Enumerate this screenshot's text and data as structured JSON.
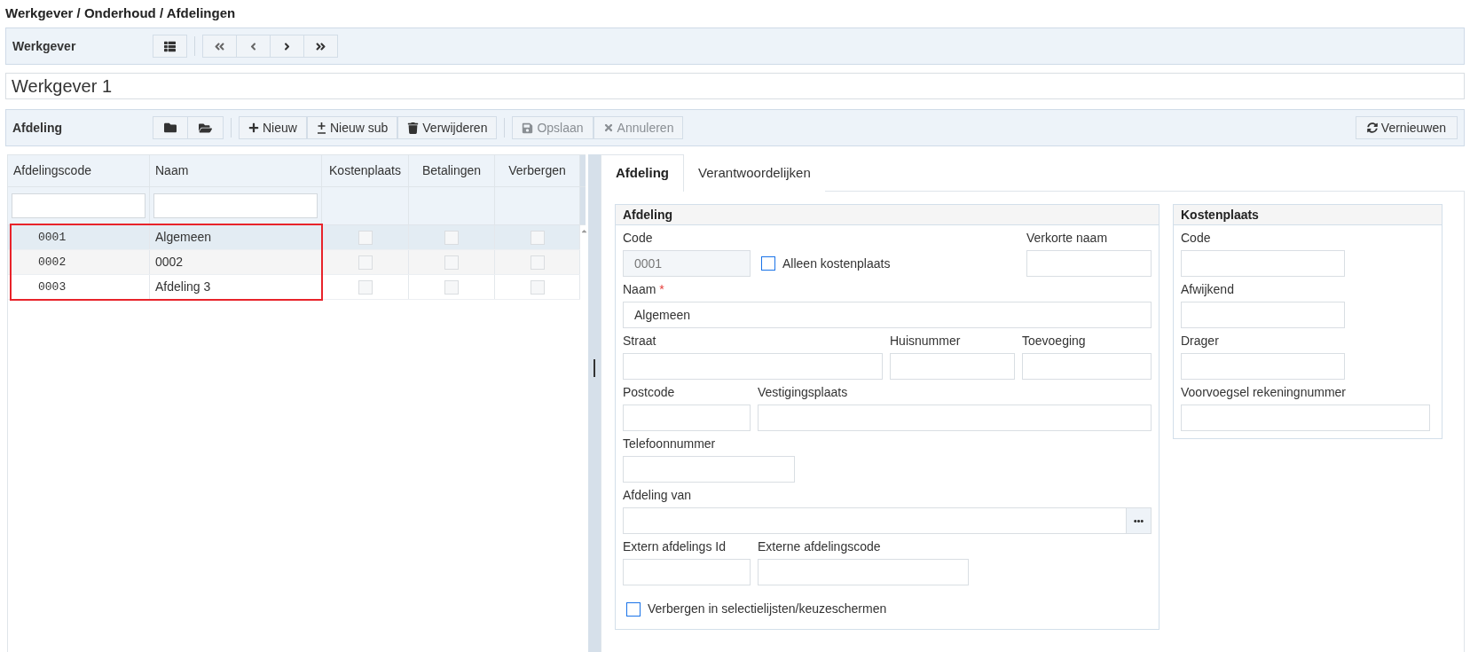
{
  "breadcrumb": "Werkgever / Onderhoud / Afdelingen",
  "employer_toolbar": {
    "label": "Werkgever"
  },
  "employer_name": "Werkgever 1",
  "department_toolbar": {
    "label": "Afdeling",
    "actions": [
      {
        "label": "Nieuw",
        "disabled": false
      },
      {
        "label": "Nieuw sub",
        "disabled": false
      },
      {
        "label": "Verwijderen",
        "disabled": false
      }
    ],
    "edit_actions": [
      {
        "label": "Opslaan",
        "disabled": true
      },
      {
        "label": "Annuleren",
        "disabled": true
      }
    ],
    "refresh": {
      "label": "Vernieuwen"
    }
  },
  "grid": {
    "columns": [
      "Afdelingscode",
      "Naam",
      "Kostenplaats",
      "Betalingen",
      "Verbergen"
    ],
    "rows": [
      {
        "code": "0001",
        "name": "Algemeen",
        "kostenplaats": false,
        "betalingen": false,
        "verbergen": false,
        "selected": true
      },
      {
        "code": "0002",
        "name": "0002",
        "kostenplaats": false,
        "betalingen": false,
        "verbergen": false,
        "selected": false
      },
      {
        "code": "0003",
        "name": "Afdeling 3",
        "kostenplaats": false,
        "betalingen": false,
        "verbergen": false,
        "selected": false
      }
    ]
  },
  "tabs": [
    {
      "label": "Afdeling",
      "selected": true
    },
    {
      "label": "Verantwoordelijken",
      "selected": false
    }
  ],
  "department_form": {
    "title": "Afdeling",
    "code": {
      "label": "Code",
      "value": "0001",
      "disabled": true
    },
    "only_cost_center": {
      "label": "Alleen kostenplaats",
      "checked": false
    },
    "short_name": {
      "label": "Verkorte naam"
    },
    "name": {
      "label": "Naam",
      "required_mark": "*",
      "value": "Algemeen"
    },
    "street": {
      "label": "Straat"
    },
    "house_number": {
      "label": "Huisnummer"
    },
    "addition": {
      "label": "Toevoeging"
    },
    "postcode": {
      "label": "Postcode"
    },
    "city": {
      "label": "Vestigingsplaats"
    },
    "phone": {
      "label": "Telefoonnummer"
    },
    "parent": {
      "label": "Afdeling van"
    },
    "external_id": {
      "label": "Extern afdelings Id"
    },
    "external_code": {
      "label": "Externe afdelingscode"
    },
    "hide": {
      "label": "Verbergen in selectielijsten/keuzeschermen",
      "checked": false
    }
  },
  "cost_center_form": {
    "title": "Kostenplaats",
    "fields": [
      {
        "label": "Code"
      },
      {
        "label": "Afwijkend"
      },
      {
        "label": "Drager"
      },
      {
        "label": "Voorvoegsel rekeningnummer"
      }
    ]
  }
}
